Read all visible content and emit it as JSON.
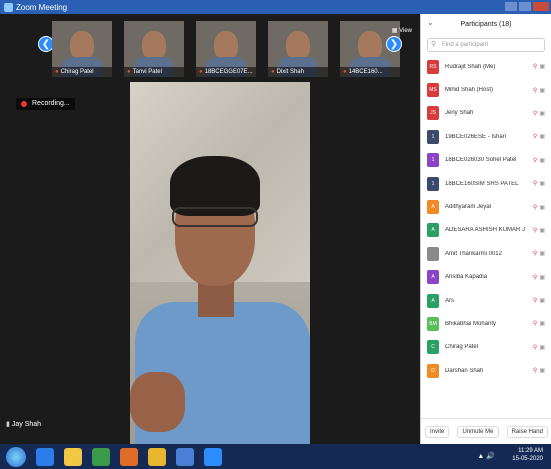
{
  "window": {
    "title": "Zoom Meeting"
  },
  "thumbnails": [
    {
      "name": "Chirag Patel"
    },
    {
      "name": "Tanvi Patel"
    },
    {
      "name": "18BCEGGE07E..."
    },
    {
      "name": "Dixit Shah"
    },
    {
      "name": "14BCE160..."
    }
  ],
  "view_button": "View",
  "recording": {
    "label": "Recording..."
  },
  "active_speaker": {
    "name": "Jay Shah"
  },
  "participants": {
    "title": "Participants (18)",
    "search_placeholder": "Find a participant",
    "items": [
      {
        "initials": "RS",
        "name": "Rudrajit Shah (Me)",
        "color": "#d83b3b"
      },
      {
        "initials": "MS",
        "name": "Mihid Shah (Host)",
        "color": "#d83b3b"
      },
      {
        "initials": "JS",
        "name": "Jeny Shah",
        "color": "#d83b3b"
      },
      {
        "initials": "1",
        "name": "19BCE026ESE - Ishan",
        "color": "#3b4a6b"
      },
      {
        "initials": "1",
        "name": "18BCE026030 Sohel Patel",
        "color": "#8a44c6"
      },
      {
        "initials": "1",
        "name": "18BCE160SIM SHS PATEL",
        "color": "#3b4a6b"
      },
      {
        "initials": "A",
        "name": "Adithyaram Jeyal",
        "color": "#f08a24"
      },
      {
        "initials": "A",
        "name": "ADESARA ASHISH KUMAR JASBI...",
        "color": "#2aa162"
      },
      {
        "initials": "",
        "name": "Amit Thankarmi 0012",
        "color": "#8a8a8a"
      },
      {
        "initials": "A",
        "name": "Ansiba Kapadia",
        "color": "#8a44c6"
      },
      {
        "initials": "A",
        "name": "Ars",
        "color": "#2aa162"
      },
      {
        "initials": "BM",
        "name": "Bhikabhai Mohanty",
        "color": "#5bbd5b"
      },
      {
        "initials": "C",
        "name": "Chirag Patel",
        "color": "#2aa162"
      },
      {
        "initials": "D",
        "name": "Darshan Shah",
        "color": "#f08a24"
      }
    ],
    "footer": {
      "invite": "Invite",
      "mute_all": "Unmute Me",
      "raise_hand": "Raise Hand"
    }
  },
  "taskbar": {
    "time": "11:29 AM",
    "date": "15-05-2020"
  }
}
